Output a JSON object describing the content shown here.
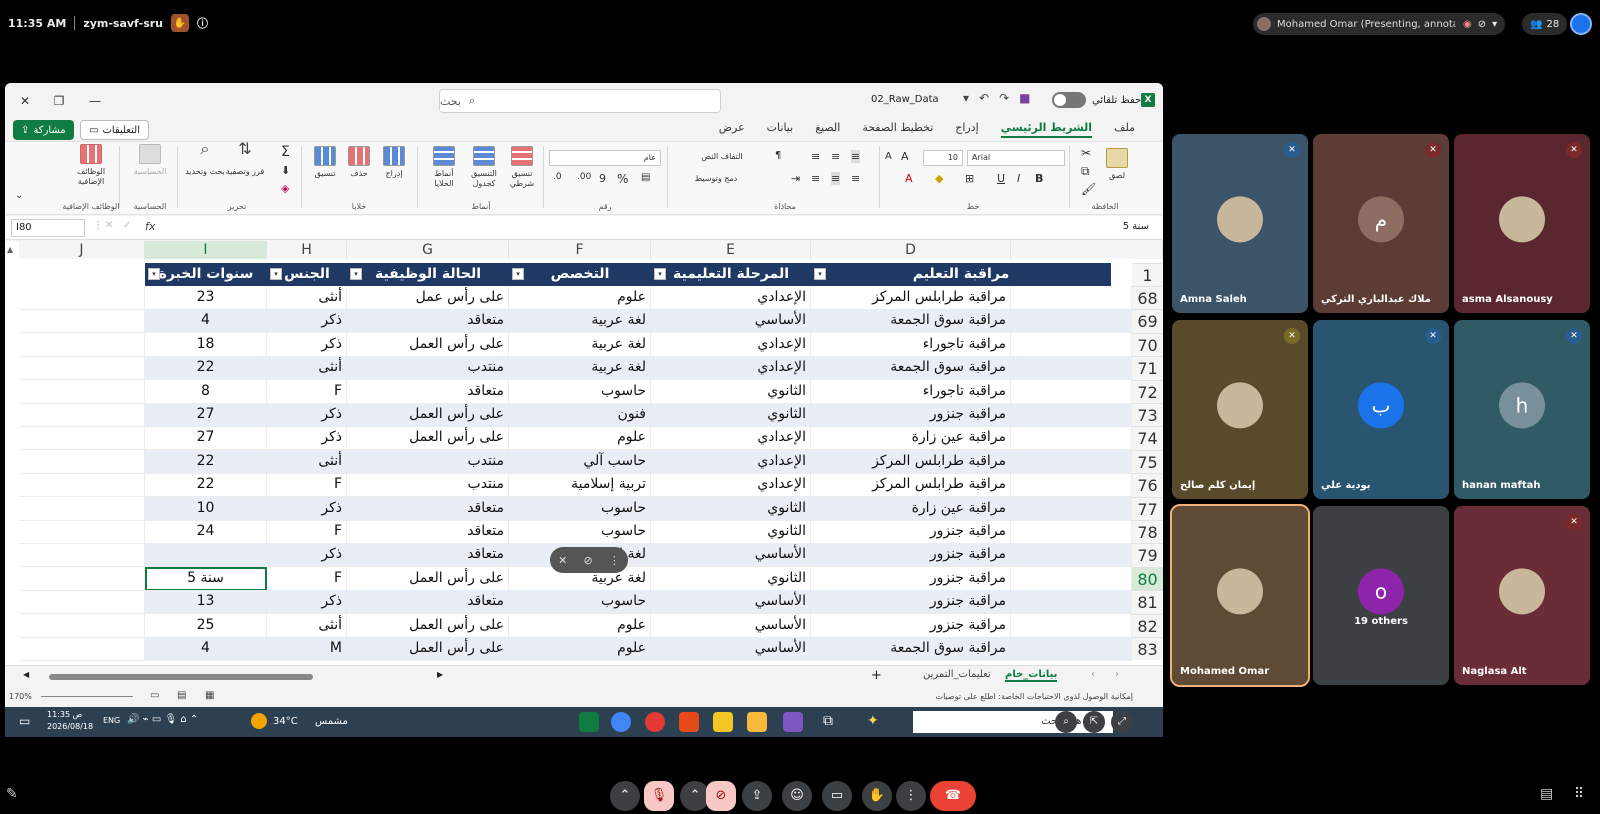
{
  "meet": {
    "time": "11:35 AM",
    "meeting_code": "zym-savf-sru",
    "presenter": "Mohamed Omar (Presenting, annotating)",
    "people_count": "28"
  },
  "excel": {
    "filename": "02_Raw_Data",
    "search_placeholder": "بحث",
    "autosave_label": "حفظ تلقائي",
    "tabs": [
      "ملف",
      "الشريط الرئيسي",
      "إدراج",
      "تخطيط الصفحة",
      "الصيغ",
      "بيانات",
      "عرض"
    ],
    "share_label": "مشاركة",
    "comments_label": "التعليقات",
    "ribbon": {
      "clipboard": "الحافظة",
      "paste": "لصق",
      "font_group": "خط",
      "font_name": "Arial",
      "font_size": "10",
      "alignment": "محاذاة",
      "wrap_text": "التفاف النص",
      "merge_center": "دمج وتوسيط",
      "number_group": "رقم",
      "number_format": "عام",
      "styles": "أنماط",
      "conditional": "تنسيق شرطي",
      "format_table": "التنسيق كجدول",
      "cell_styles": "أنماط الخلايا",
      "cells": "خلايا",
      "insert": "إدراج",
      "delete": "حذف",
      "format": "تنسيق",
      "editing": "تحرير",
      "sort_filter": "فرز وتصفية",
      "find_select": "بحث وتحديد",
      "sensitivity": "الحساسية",
      "addins": "الوظائف الإضافية"
    },
    "name_box": "I80",
    "formula_content": "سنة 5",
    "columns": [
      "J",
      "I",
      "H",
      "G",
      "F",
      "E",
      "D"
    ],
    "headers": {
      "D": "مراقبة التعليم",
      "E": "المرحلة التعليمية",
      "F": "التخصص",
      "G": "الحالة الوظيفية",
      "H": "الجنس",
      "I": "سنوات الخبرة"
    },
    "header_row_number": "1",
    "rows": [
      {
        "n": "68",
        "D": "مراقبة طرابلس المركز",
        "E": "الإعدادي",
        "F": "علوم",
        "G": "على رأس عمل",
        "H": "أنثى",
        "I": "23"
      },
      {
        "n": "69",
        "D": "مراقبة سوق الجمعة",
        "E": "الأساسي",
        "F": "لغة عربية",
        "G": "متعاقد",
        "H": "ذكر",
        "I": "4"
      },
      {
        "n": "70",
        "D": "مراقبة تاجوراء",
        "E": "الإعدادي",
        "F": "لغة عربية",
        "G": "على رأس العمل",
        "H": "ذكر",
        "I": "18"
      },
      {
        "n": "71",
        "D": "مراقبة سوق الجمعة",
        "E": "الإعدادي",
        "F": "لغة عربية",
        "G": "منتدب",
        "H": "أنثى",
        "I": "22"
      },
      {
        "n": "72",
        "D": "مراقبة تاجوراء",
        "E": "الثانوي",
        "F": "حاسوب",
        "G": "متعاقد",
        "H": "F",
        "I": "8"
      },
      {
        "n": "73",
        "D": "مراقبة جنزور",
        "E": "الثانوي",
        "F": "فنون",
        "G": "على رأس العمل",
        "H": "ذكر",
        "I": "27"
      },
      {
        "n": "74",
        "D": "مراقبة عين زارة",
        "E": "الإعدادي",
        "F": "علوم",
        "G": "على رأس العمل",
        "H": "ذكر",
        "I": "27"
      },
      {
        "n": "75",
        "D": "مراقبة طرابلس المركز",
        "E": "الإعدادي",
        "F": "حاسب آلي",
        "G": "منتدب",
        "H": "أنثى",
        "I": "22"
      },
      {
        "n": "76",
        "D": "مراقبة طرابلس المركز",
        "E": "الإعدادي",
        "F": "تربية إسلامية",
        "G": "منتدب",
        "H": "F",
        "I": "22"
      },
      {
        "n": "77",
        "D": "مراقبة عين زارة",
        "E": "الثانوي",
        "F": "حاسوب",
        "G": "متعاقد",
        "H": "ذكر",
        "I": "10"
      },
      {
        "n": "78",
        "D": "مراقبة جنزور",
        "E": "الثانوي",
        "F": "حاسوب",
        "G": "متعاقد",
        "H": "F",
        "I": "24"
      },
      {
        "n": "79",
        "D": "مراقبة جنزور",
        "E": "الأساسي",
        "F": "لغة إنجليزية",
        "G": "متعاقد",
        "H": "ذكر",
        "I": ""
      },
      {
        "n": "80",
        "D": "مراقبة جنزور",
        "E": "الثانوي",
        "F": "لغة عربية",
        "G": "على رأس العمل",
        "H": "F",
        "I": "سنة 5"
      },
      {
        "n": "81",
        "D": "مراقبة جنزور",
        "E": "الأساسي",
        "F": "حاسوب",
        "G": "متعاقد",
        "H": "ذكر",
        "I": "13"
      },
      {
        "n": "82",
        "D": "مراقبة جنزور",
        "E": "الأساسي",
        "F": "علوم",
        "G": "على رأس العمل",
        "H": "أنثى",
        "I": "25"
      },
      {
        "n": "83",
        "D": "مراقبة سوق الجمعة",
        "E": "الأساسي",
        "F": "علوم",
        "G": "على رأس العمل",
        "H": "M",
        "I": "4"
      }
    ],
    "sheets": [
      "بيانات_خام",
      "تعليمات_التمرين"
    ],
    "accessibility_note": "إمكانية الوصول لذوي الاحتياجات الخاصة: اطلع على توصيات",
    "zoom": "170%",
    "taskbar": {
      "time": "11:35 ص",
      "date": "2026/08/18",
      "lang": "ENG",
      "temp": "34°C",
      "weather": "مشمس",
      "search": "اكتب هنا للبحث"
    }
  },
  "participants": [
    {
      "name": "Amna Saleh",
      "initial": "",
      "color": "#3b5468"
    },
    {
      "name": "ملاك عبدالباري التركي",
      "initial": "م",
      "color": "#5b3d36"
    },
    {
      "name": "asma Alsanousy",
      "initial": "",
      "color": "#5a2630"
    },
    {
      "name": "إيمان كلم صالح",
      "initial": "",
      "color": "#5a4a2c"
    },
    {
      "name": "بودية علي",
      "initial": "ب",
      "color": "#2a5570"
    },
    {
      "name": "hanan maftah",
      "initial": "h",
      "color": "#2f5a66"
    },
    {
      "name": "Mohamed Omar",
      "initial": "",
      "color": "#5f4a36"
    },
    {
      "name": "19 others",
      "initial": "o",
      "color": "#3c4043"
    },
    {
      "name": "Naglasa Alt",
      "initial": "",
      "color": "#6a2c36"
    }
  ],
  "colors": {
    "excel_green": "#107c41",
    "header_navy": "#1f3864",
    "end_call": "#ea4335"
  }
}
